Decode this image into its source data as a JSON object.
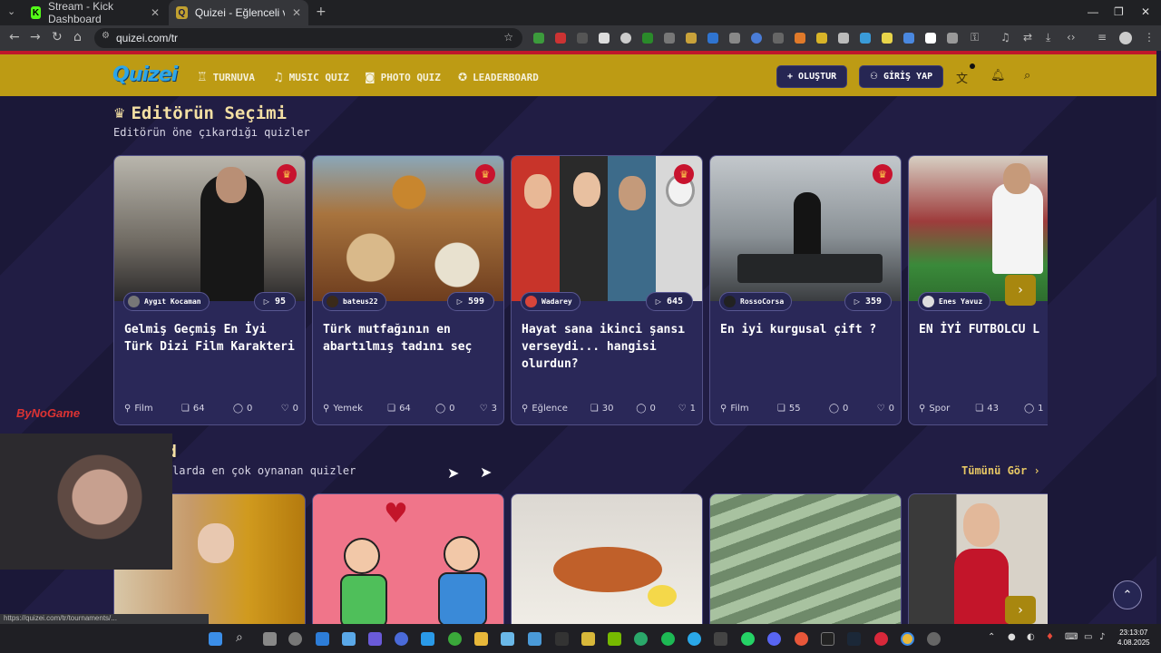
{
  "browser": {
    "tabs": [
      {
        "title": "Stream - Kick Dashboard",
        "active": false
      },
      {
        "title": "Quizei - Eğlenceli ve etkileşimli",
        "active": true
      }
    ],
    "url": "quizei.com/tr",
    "status_url": "https://quizei.com/tr/tournaments/..."
  },
  "site": {
    "logo": "Quizei",
    "nav": [
      "TURNUVA",
      "MUSIC QUIZ",
      "PHOTO QUIZ",
      "LEADERBOARD"
    ],
    "create_button": "OLUŞTUR",
    "login_button": "GİRİŞ YAP"
  },
  "editors": {
    "title": "Editörün Seçimi",
    "subtitle": "Editörün öne çıkardığı quizler",
    "cards": [
      {
        "author": "Aygıt Kocaman",
        "plays": "95",
        "title": "Gelmiş Geçmiş En İyi Türk Dizi Film Karakteri",
        "category": "Film",
        "questions": "64",
        "comments": "0",
        "likes": "0"
      },
      {
        "author": "bateus22",
        "plays": "599",
        "title": "Türk mutfağının en abartılmış tadını seç",
        "category": "Yemek",
        "questions": "64",
        "comments": "0",
        "likes": "3"
      },
      {
        "author": "Wadarey",
        "plays": "645",
        "title": "Hayat sana ikinci şansı verseydi... hangisi olurdun?",
        "category": "Eğlence",
        "questions": "30",
        "comments": "0",
        "likes": "1"
      },
      {
        "author": "RossoCorsa",
        "plays": "359",
        "title": "En iyi kurgusal çift ?",
        "category": "Film",
        "questions": "55",
        "comments": "0",
        "likes": "0"
      },
      {
        "author": "Enes Yavuz",
        "plays": "",
        "title": "EN İYİ FUTBOLCU L",
        "category": "Spor",
        "questions": "43",
        "comments": "1",
        "likes": ""
      }
    ]
  },
  "trend": {
    "title_partial": "nd",
    "subtitle_partial": "larda en çok oynanan quizler",
    "see_all": "Tümünü Gör"
  },
  "overlays": {
    "watermark": "ByNoGame"
  },
  "taskbar": {
    "time": "23:13:07",
    "date": "4.08.2025"
  }
}
